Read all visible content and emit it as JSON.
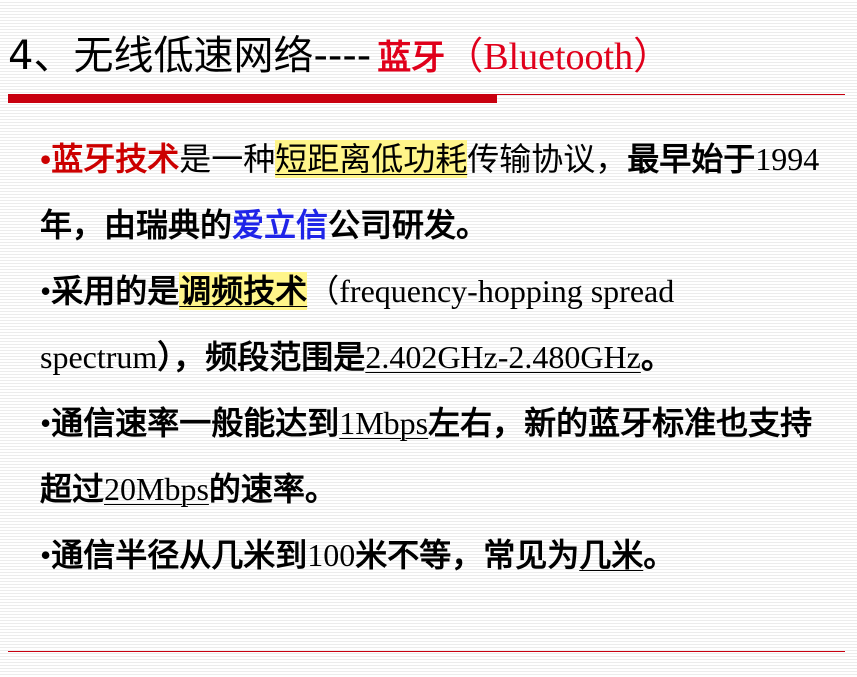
{
  "title": {
    "main": "4、无线低速网络----",
    "highlight": "蓝牙",
    "paren_open": "（",
    "paren_text": "Bluetooth",
    "paren_close": "）"
  },
  "paragraphs": {
    "p1": {
      "bullet": "•",
      "term": "蓝牙技术",
      "t1": "是一种",
      "hl": "短距离低功耗",
      "t2": "传输协议，",
      "t3": "最早始于",
      "year": "1994",
      "t4": "年，由瑞典的",
      "company": "爱立信",
      "t5": "公司研发。"
    },
    "p2": {
      "bullet": "•",
      "t1": "采用的是",
      "hl": "调频技术",
      "t2": "（",
      "eng": "frequency-hopping spread spectrum",
      "t3": "），频段范围是",
      "range": "2.402GHz-2.480GHz",
      "t4": "。"
    },
    "p3": {
      "bullet": "•",
      "t1": "通信速率一般能达到",
      "rate1": "1Mbps",
      "t2": "左右，新的蓝牙标准也支持超过",
      "rate2": "20Mbps",
      "t3": "的速率。"
    },
    "p4": {
      "bullet": "•",
      "t1": "通信半径从几米到",
      "num": "100",
      "t2": "米不等，常见为",
      "ul": "几米",
      "t3": "。"
    }
  },
  "colors": {
    "accent_red": "#c8000f",
    "term_red": "#cc0000",
    "highlight_yellow": "#fff58a",
    "link_blue": "#1f24e8"
  }
}
